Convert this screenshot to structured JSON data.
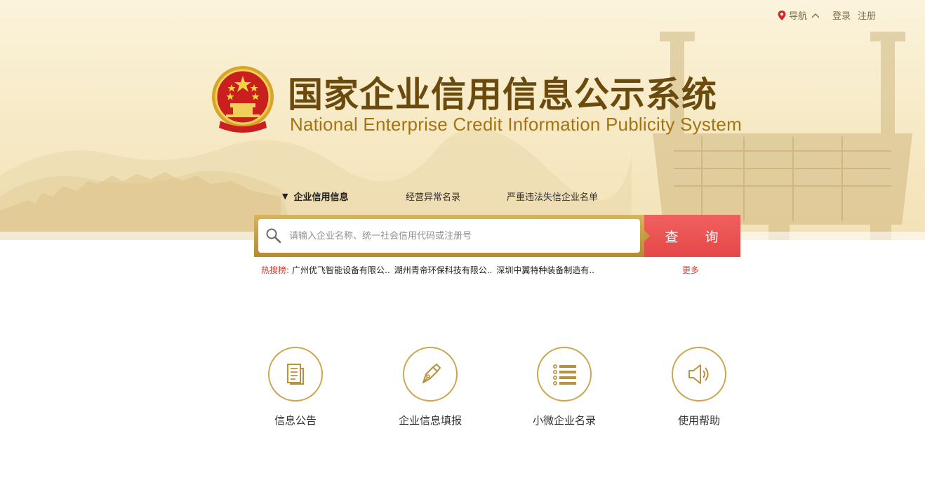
{
  "topnav": {
    "nav_label": "导航",
    "login": "登录",
    "register": "注册"
  },
  "header": {
    "title_cn": "国家企业信用信息公示系统",
    "title_en": "National Enterprise Credit Information Publicity System"
  },
  "tabs": [
    {
      "label": "企业信用信息",
      "active": true
    },
    {
      "label": "经营异常名录",
      "active": false
    },
    {
      "label": "严重违法失信企业名单",
      "active": false
    }
  ],
  "search": {
    "placeholder": "请输入企业名称、统一社会信用代码或注册号",
    "button_label": "查 询"
  },
  "hot": {
    "label": "热搜榜:",
    "items": [
      "广州优飞智能设备有限公..",
      "湖州青帝环保科技有限公..",
      "深圳中翼特种装备制造有.."
    ],
    "more": "更多"
  },
  "services": [
    {
      "label": "信息公告",
      "icon": "document-icon"
    },
    {
      "label": "企业信息填报",
      "icon": "pen-icon"
    },
    {
      "label": "小微企业名录",
      "icon": "list-icon"
    },
    {
      "label": "使用帮助",
      "icon": "speaker-icon"
    }
  ],
  "colors": {
    "gold": "#c9a64f",
    "brown_title": "#6b4a0e",
    "red_button": "#e54747",
    "hot_red": "#d93b2b"
  }
}
